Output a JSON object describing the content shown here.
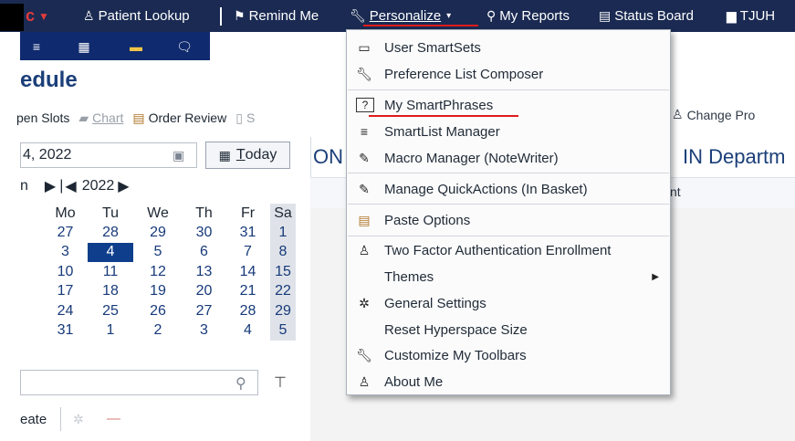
{
  "topbar": {
    "patient_lookup": "Patient Lookup",
    "remind_me": "Remind Me",
    "personalize": "Personalize",
    "my_reports": "My Reports",
    "status_board": "Status Board",
    "tjuh": "TJUH"
  },
  "schedule": {
    "title": "edule",
    "actions": {
      "open_slots": "pen Slots",
      "chart": "Chart",
      "order_review": "Order Review",
      "s_cut": "S",
      "change_profile": "Change Pro"
    },
    "date_value": "4, 2022",
    "today_u": "T",
    "today_rest": "oday",
    "calendar": {
      "month_cut": "n",
      "year": "2022",
      "headers": [
        "",
        "Mo",
        "Tu",
        "We",
        "Th",
        "Fr",
        "Sa"
      ],
      "weeks": [
        [
          "",
          "27",
          "28",
          "29",
          "30",
          "31",
          "1"
        ],
        [
          "",
          "3",
          "4",
          "5",
          "6",
          "7",
          "8"
        ],
        [
          "",
          "10",
          "11",
          "12",
          "13",
          "14",
          "15"
        ],
        [
          "",
          "17",
          "18",
          "19",
          "20",
          "21",
          "22"
        ],
        [
          "",
          "24",
          "25",
          "26",
          "27",
          "28",
          "29"
        ],
        [
          "",
          "31",
          "1",
          "2",
          "3",
          "4",
          "5"
        ]
      ],
      "selected_day": "4"
    },
    "create": "eate"
  },
  "department": {
    "heading_left": "ON",
    "heading_right": "IN Departm",
    "column_cut": "nt"
  },
  "menu": {
    "items": [
      {
        "label": "User SmartSets",
        "icon": "monitor-icon"
      },
      {
        "label": "Preference List Composer",
        "icon": "wrench-icon"
      },
      {
        "label": "My SmartPhrases",
        "icon": "smartphrase-icon"
      },
      {
        "label": "SmartList Manager",
        "icon": "list-icon"
      },
      {
        "label": "Macro Manager (NoteWriter)",
        "icon": "pencil-icon"
      },
      {
        "label": "Manage QuickActions (In Basket)",
        "icon": "pencil-icon"
      },
      {
        "label": "Paste Options",
        "icon": "clipboard-icon"
      },
      {
        "label": "Two Factor Authentication Enrollment",
        "icon": "user-key-icon"
      },
      {
        "label": "Themes",
        "icon": ""
      },
      {
        "label": "General Settings",
        "icon": "gears-icon"
      },
      {
        "label": "Reset Hyperspace Size",
        "icon": ""
      },
      {
        "label": "Customize My Toolbars",
        "icon": "wrench-icon"
      },
      {
        "label": "About Me",
        "icon": "user-gear-icon"
      }
    ]
  }
}
